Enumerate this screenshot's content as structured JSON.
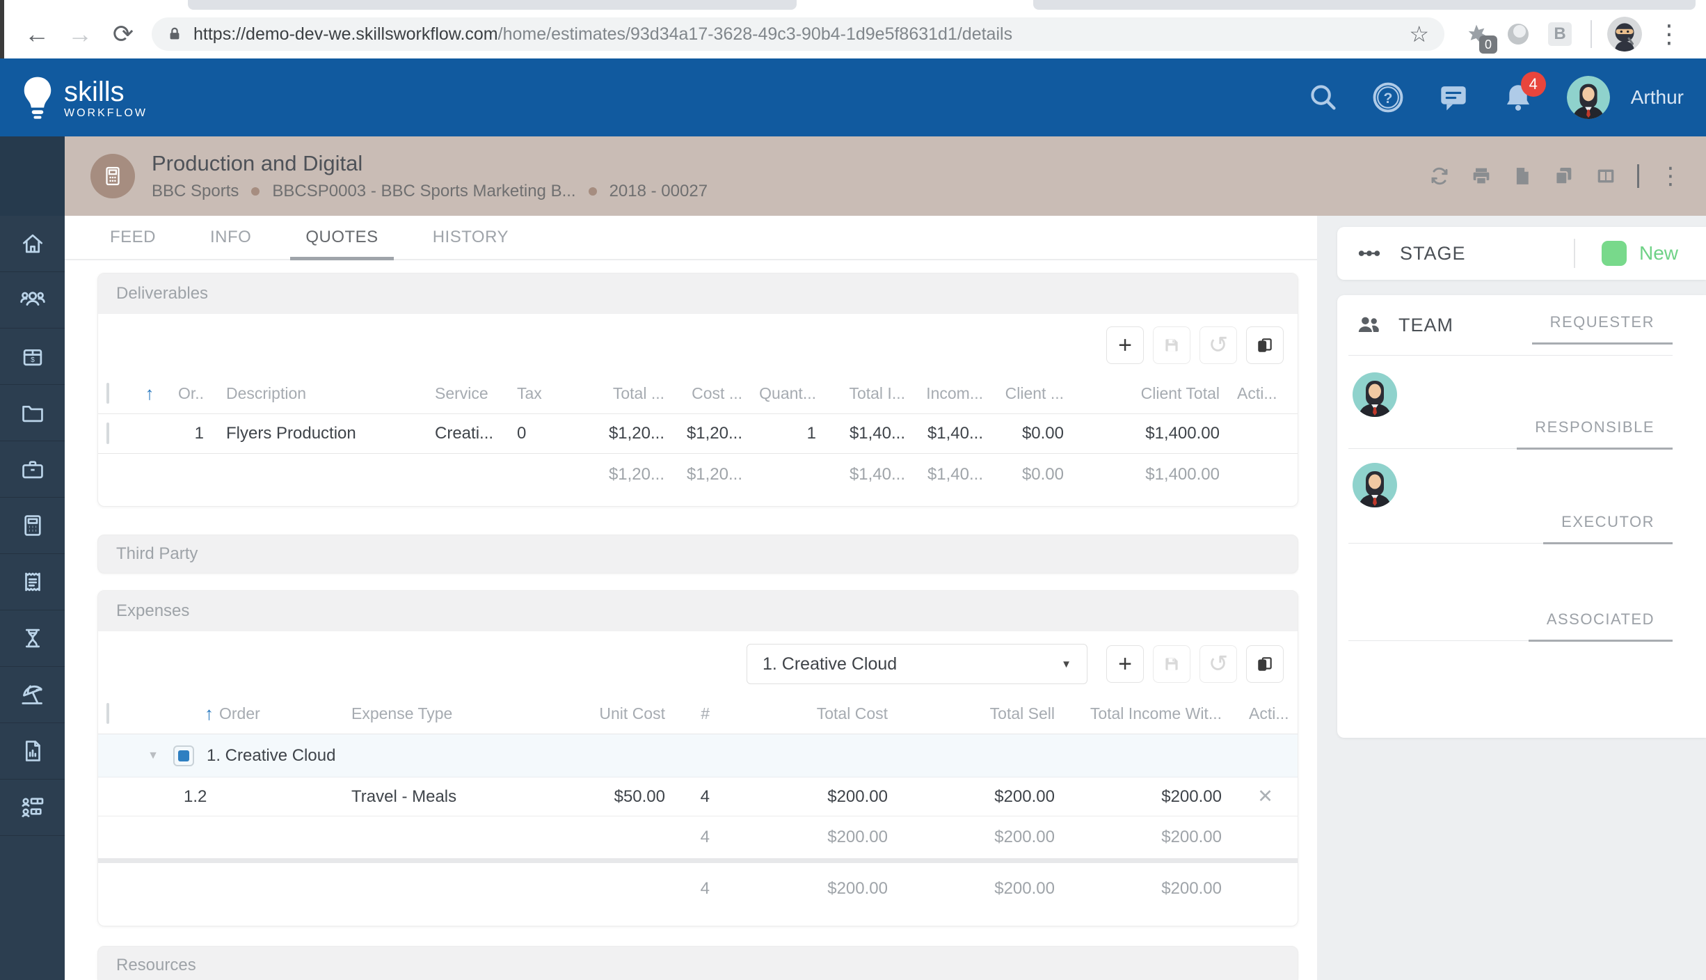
{
  "browser": {
    "back": "←",
    "forward": "→",
    "reload": "⟳",
    "url_domain": "https://demo-dev-we.skillsworkflow.com",
    "url_path": "/home/estimates/93d34a17-3628-49c3-90b4-1d9e5f8631d1/details",
    "bookmark_star": "☆",
    "extension_badge": "0",
    "extension_b": "B",
    "menu_dots": "⋮"
  },
  "app_header": {
    "logo_title": "skills",
    "logo_subtitle": "WORKFLOW",
    "notification_count": "4",
    "user_name": "Arthur"
  },
  "page_header": {
    "title": "Production and Digital",
    "client": "BBC Sports",
    "campaign": "BBCSP0003 - BBC Sports Marketing B...",
    "job_number": "2018 - 00027"
  },
  "tabs": {
    "feed": "FEED",
    "info": "INFO",
    "quotes": "QUOTES",
    "history": "HISTORY"
  },
  "deliverables": {
    "title": "Deliverables",
    "columns": {
      "order": "Or..",
      "description": "Description",
      "service": "Service",
      "tax": "Tax",
      "total_cost": "Total ...",
      "cost": "Cost ...",
      "quantity": "Quant...",
      "total_income": "Total I...",
      "income": "Incom...",
      "client": "Client ...",
      "client_total": "Client Total",
      "actions": "Acti..."
    },
    "row": {
      "order": "1",
      "description": "Flyers Production",
      "service": "Creati...",
      "tax": "0",
      "total_cost": "$1,20...",
      "cost": "$1,20...",
      "quantity": "1",
      "total_income": "$1,40...",
      "income": "$1,40...",
      "client": "$0.00",
      "client_total": "$1,400.00"
    },
    "totals": {
      "total_cost": "$1,20...",
      "cost": "$1,20...",
      "total_income": "$1,40...",
      "income": "$1,40...",
      "client": "$0.00",
      "client_total": "$1,400.00"
    }
  },
  "third_party": {
    "title": "Third Party"
  },
  "expenses": {
    "title": "Expenses",
    "group_select": "1. Creative Cloud",
    "columns": {
      "order": "Order",
      "type": "Expense Type",
      "unit_cost": "Unit Cost",
      "qty": "#",
      "total_cost": "Total Cost",
      "total_sell": "Total Sell",
      "total_income": "Total Income Wit...",
      "actions": "Acti..."
    },
    "group_label": "1. Creative Cloud",
    "row": {
      "order": "1.2",
      "type": "Travel - Meals",
      "unit_cost": "$50.00",
      "qty": "4",
      "total_cost": "$200.00",
      "total_sell": "$200.00",
      "total_income": "$200.00"
    },
    "group_totals": {
      "qty": "4",
      "total_cost": "$200.00",
      "total_sell": "$200.00",
      "total_income": "$200.00"
    },
    "grand_totals": {
      "qty": "4",
      "total_cost": "$200.00",
      "total_sell": "$200.00",
      "total_income": "$200.00"
    }
  },
  "resources": {
    "title": "Resources"
  },
  "stage": {
    "title": "STAGE",
    "value": "New",
    "chip_color": "#78D98B",
    "value_color": "#6FD286"
  },
  "team": {
    "title": "TEAM",
    "roles": {
      "requester": "REQUESTER",
      "responsible": "RESPONSIBLE",
      "executor": "EXECUTOR",
      "associated": "ASSOCIATED"
    }
  },
  "icons": {
    "plus": "+",
    "undo": "↺",
    "sort_asc": "↑",
    "caret_down": "▼",
    "close": "✕"
  }
}
